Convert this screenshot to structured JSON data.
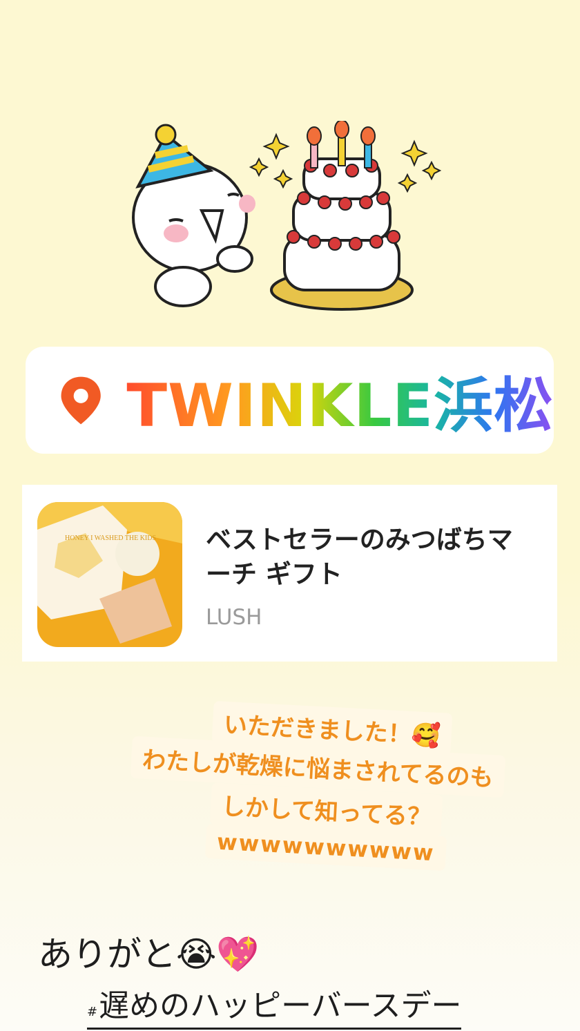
{
  "location": {
    "label": "TWINKLE浜松",
    "pin_color": "#f15a24"
  },
  "product": {
    "title": "ベストセラーのみつばちマーチ ギフト",
    "brand": "LUSH",
    "image_text": "HONEY I WASHED THE KIDS"
  },
  "caption": {
    "lines": [
      "いただきました！🥰",
      "わたしが乾燥に悩まされてるのも",
      "しかして知ってる？",
      "wwwwwwwwww"
    ],
    "color": "#ef8f1f"
  },
  "thanks": "ありがと😭💖",
  "hashtag": {
    "mark": "#",
    "text": "遅めのハッピーバースデー"
  }
}
